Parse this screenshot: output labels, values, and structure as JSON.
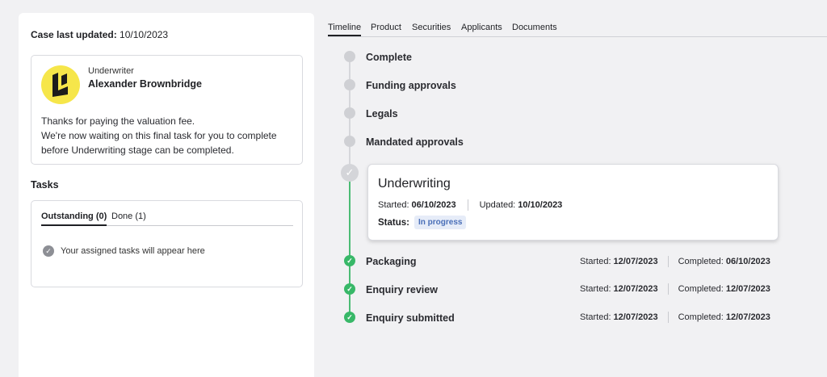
{
  "case": {
    "label": "Case last updated:",
    "value": "10/10/2023"
  },
  "underwriter": {
    "role": "Underwriter",
    "name": "Alexander Brownbridge",
    "message_lines": [
      "Thanks for paying the valuation fee.",
      "We're now waiting on this final task for you to complete",
      "before Underwriting stage can be completed."
    ]
  },
  "tasks": {
    "title": "Tasks",
    "tabs": [
      "Outstanding (0)",
      "Done (1)"
    ],
    "empty_text": "Your assigned tasks will appear here"
  },
  "nav_tabs": [
    "Timeline",
    "Product",
    "Securities",
    "Applicants",
    "Documents"
  ],
  "timeline": {
    "pending": [
      "Complete",
      "Funding approvals",
      "Legals",
      "Mandated approvals"
    ],
    "current": {
      "title": "Underwriting",
      "started_label": "Started:",
      "started": "06/10/2023",
      "updated_label": "Updated:",
      "updated": "10/10/2023",
      "status_label": "Status:",
      "status": "In progress"
    },
    "done": [
      {
        "name": "Packaging",
        "started_label": "Started:",
        "started": "12/07/2023",
        "completed_label": "Completed:",
        "completed": "06/10/2023"
      },
      {
        "name": "Enquiry review",
        "started_label": "Started:",
        "started": "12/07/2023",
        "completed_label": "Completed:",
        "completed": "12/07/2023"
      },
      {
        "name": "Enquiry submitted",
        "started_label": "Started:",
        "started": "12/07/2023",
        "completed_label": "Completed:",
        "completed": "12/07/2023"
      }
    ]
  },
  "colors": {
    "accent_green": "#38b868",
    "avatar_yellow": "#f6e64a",
    "status_badge": "#4a6fb8"
  }
}
